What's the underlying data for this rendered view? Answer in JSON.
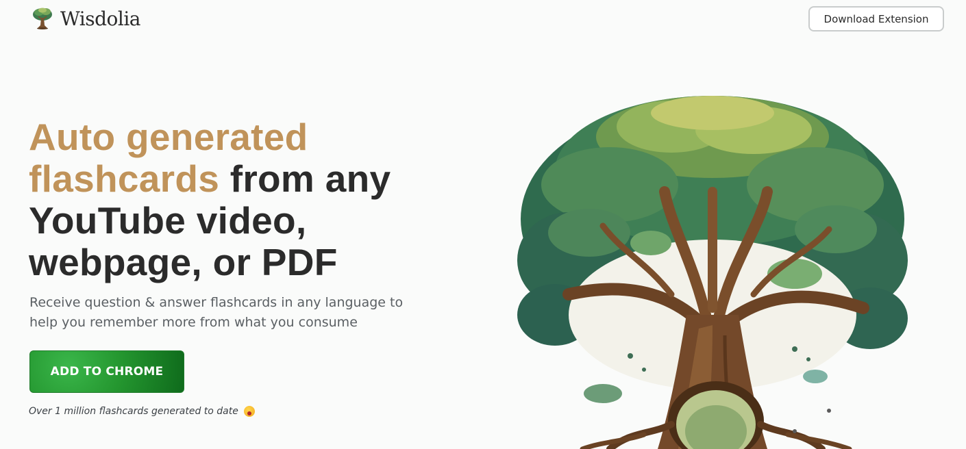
{
  "header": {
    "brand_name": "Wisdolia",
    "logo_icon": "tree-icon",
    "download_label": "Download Extension"
  },
  "hero": {
    "headline_accent": "Auto generated flashcards",
    "headline_rest": " from any YouTube video, webpage, or PDF",
    "subtext": "Receive question & answer flashcards in any language to help you remember more from what you consume",
    "cta_label": "ADD TO CHROME",
    "counter_text": "Over 1 million flashcards generated to date",
    "counter_emoji": "astonished-face-emoji",
    "illustration": "tree-of-knowledge-illustration"
  },
  "colors": {
    "accent": "#c0935a",
    "heading": "#2b2b2b",
    "cta_green": "#24962f",
    "background": "#fafbfa"
  }
}
